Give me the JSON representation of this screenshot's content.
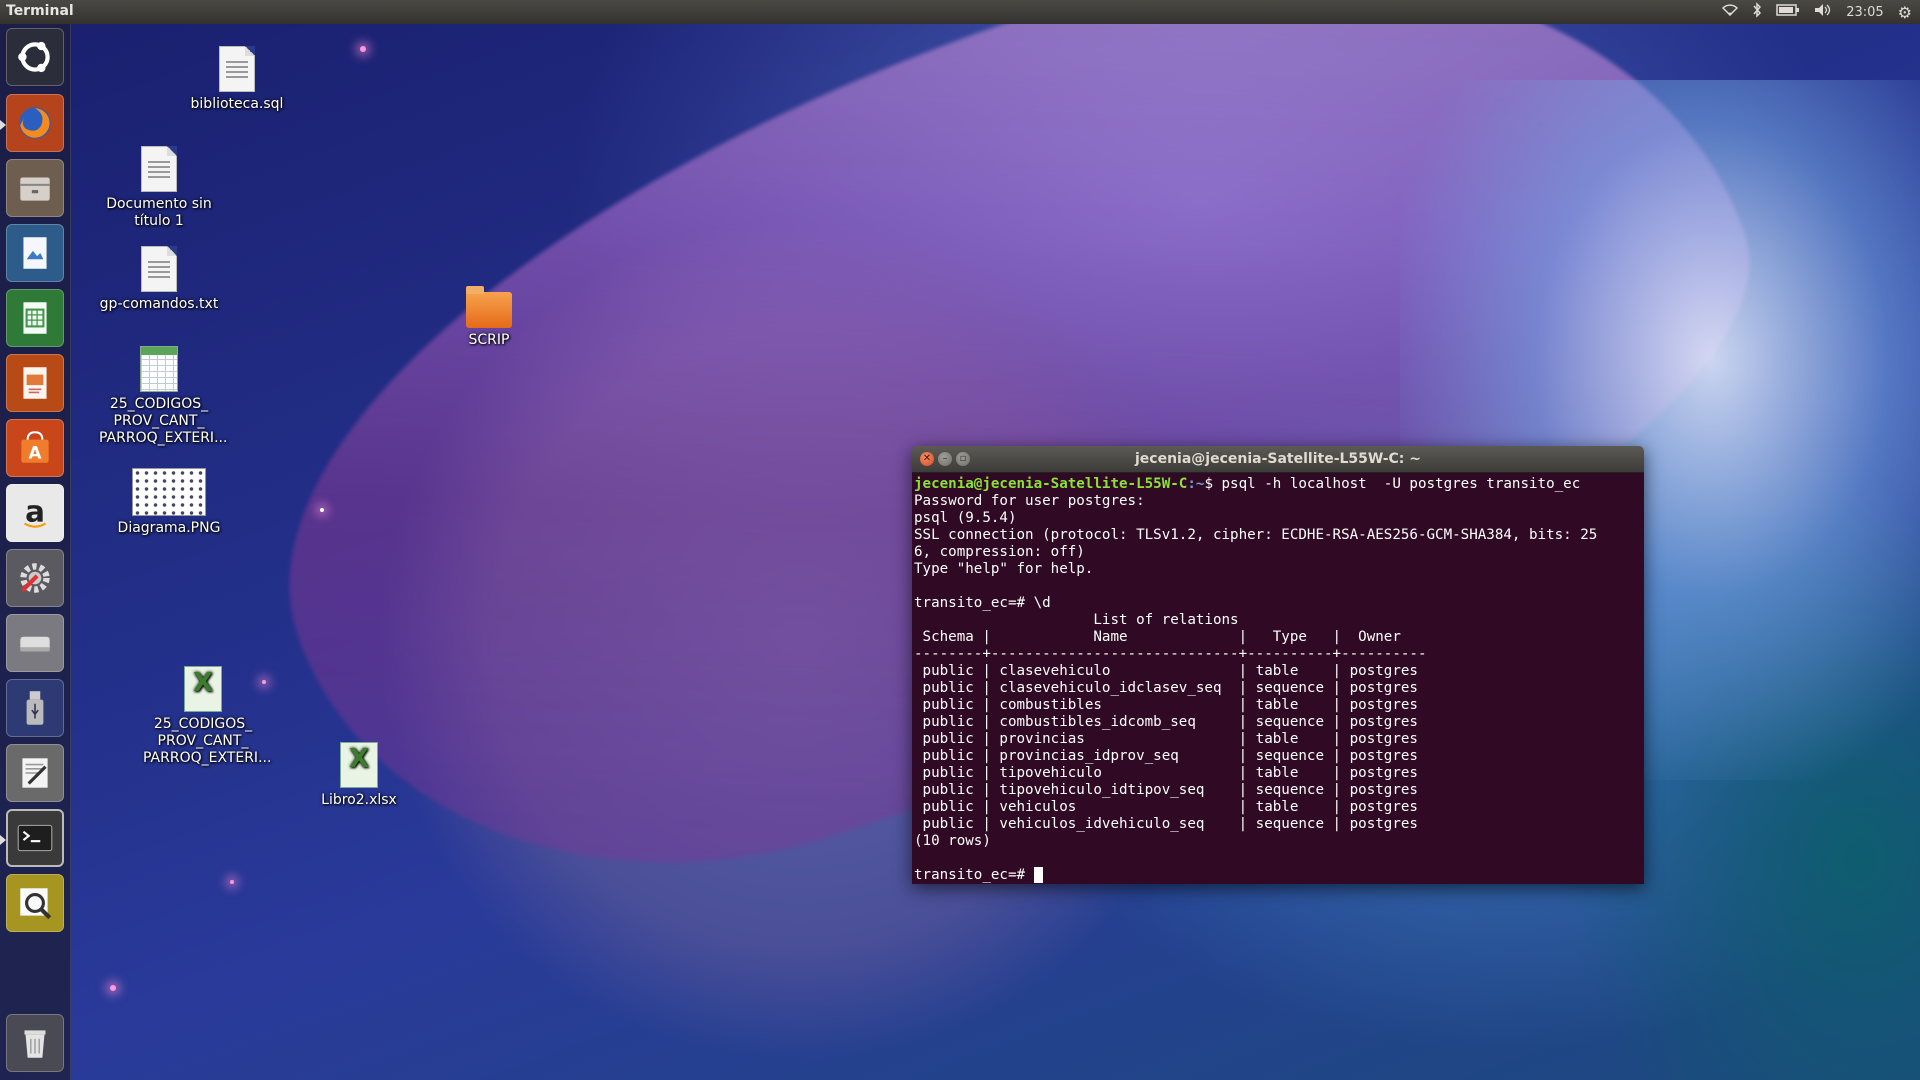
{
  "top_panel": {
    "app_title": "Terminal",
    "clock": "23:05",
    "icons": [
      "wifi-icon",
      "bluetooth-icon",
      "battery-icon",
      "volume-icon",
      "settings-gear-icon"
    ]
  },
  "launcher": {
    "items": [
      {
        "name": "ubuntu-dash-icon",
        "color": "#2c2c2c"
      },
      {
        "name": "firefox-icon",
        "color": "#e66000"
      },
      {
        "name": "files-icon",
        "color": "#8a7a6a"
      },
      {
        "name": "libreoffice-draw-icon",
        "color": "#2d6aa8"
      },
      {
        "name": "libreoffice-calc-icon",
        "color": "#2e8b3a"
      },
      {
        "name": "libreoffice-impress-icon",
        "color": "#d35400"
      },
      {
        "name": "software-center-icon",
        "color": "#e2561b"
      },
      {
        "name": "amazon-icon",
        "color": "#f0f0f0"
      },
      {
        "name": "system-settings-icon",
        "color": "#777777"
      },
      {
        "name": "disk-drive-icon",
        "color": "#9a9a9a"
      },
      {
        "name": "usb-drive-icon",
        "color": "#3a4a8a"
      },
      {
        "name": "text-editor-icon",
        "color": "#dddddd"
      },
      {
        "name": "terminal-icon",
        "color": "#2b2b2b"
      },
      {
        "name": "image-viewer-icon",
        "color": "#c8b030"
      },
      {
        "name": "trash-icon",
        "color": "#cfcfcf"
      }
    ]
  },
  "desktop": {
    "icons": [
      {
        "label": "biblioteca.sql",
        "kind": "document"
      },
      {
        "label": "Documento sin título 1",
        "kind": "document"
      },
      {
        "label": "gp-comandos.txt",
        "kind": "document"
      },
      {
        "label": "25_CODIGOS_ PROV_CANT_ PARROQ_EXTERI...",
        "kind": "spreadsheet"
      },
      {
        "label": "Diagrama.PNG",
        "kind": "image"
      },
      {
        "label": "SCRIP",
        "kind": "folder"
      },
      {
        "label": "25_CODIGOS_ PROV_CANT_ PARROQ_EXTERI...",
        "kind": "excel"
      },
      {
        "label": "Libro2.xlsx",
        "kind": "excel"
      }
    ]
  },
  "terminal": {
    "title": "jecenia@jecenia-Satellite-L55W-C: ~",
    "prompt_user": "jecenia@jecenia-Satellite-L55W-C",
    "prompt_path": ":~",
    "command": "$ psql -h localhost  -U postgres transito_ec",
    "output_lines": [
      "Password for user postgres:",
      "psql (9.5.4)",
      "SSL connection (protocol: TLSv1.2, cipher: ECDHE-RSA-AES256-GCM-SHA384, bits: 25",
      "6, compression: off)",
      "Type \"help\" for help.",
      "",
      "transito_ec=# \\d",
      "                     List of relations",
      " Schema |            Name             |   Type   |  Owner   ",
      "--------+-----------------------------+----------+----------",
      " public | clasevehiculo               | table    | postgres",
      " public | clasevehiculo_idclasev_seq  | sequence | postgres",
      " public | combustibles                | table    | postgres",
      " public | combustibles_idcomb_seq     | sequence | postgres",
      " public | provincias                  | table    | postgres",
      " public | provincias_idprov_seq       | sequence | postgres",
      " public | tipovehiculo                | table    | postgres",
      " public | tipovehiculo_idtipov_seq    | sequence | postgres",
      " public | vehiculos                   | table    | postgres",
      " public | vehiculos_idvehiculo_seq    | sequence | postgres",
      "(10 rows)",
      ""
    ],
    "final_prompt": "transito_ec=# "
  }
}
